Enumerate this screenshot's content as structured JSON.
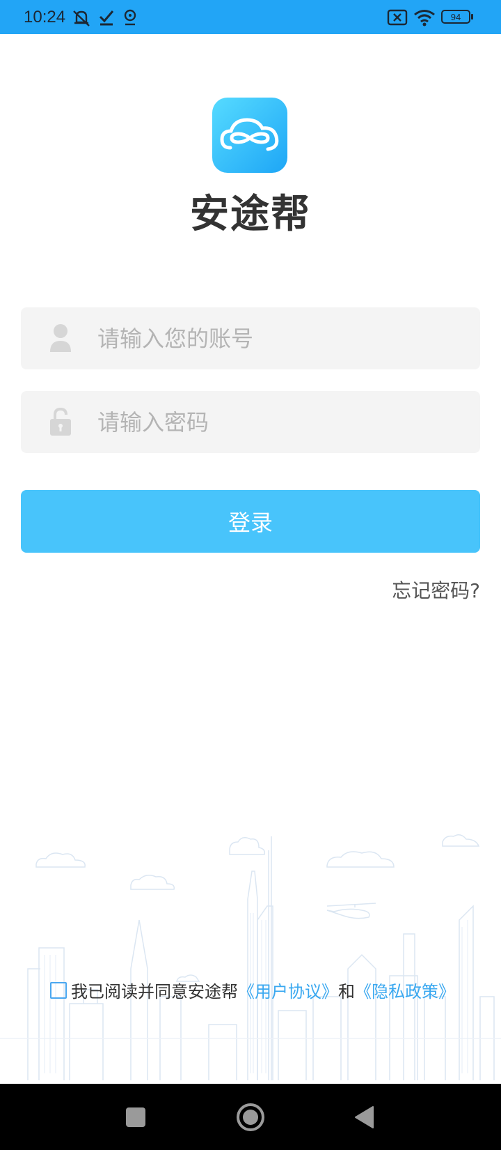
{
  "status_bar": {
    "time": "10:24",
    "battery": "94",
    "icons": [
      "mute-icon",
      "checkmark-icon",
      "location-icon",
      "sim-blocked-icon",
      "wifi-icon",
      "battery-icon"
    ]
  },
  "app": {
    "name": "安途帮",
    "logo_icon": "cloud-infinity-icon",
    "accent_color": "#48c4fb"
  },
  "login_form": {
    "account_placeholder": "请输入您的账号",
    "account_value": "",
    "password_placeholder": "请输入密码",
    "password_value": "",
    "login_label": "登录",
    "forgot_label": "忘记密码?"
  },
  "agreement": {
    "checked": false,
    "prefix": "我已阅读并同意安途帮",
    "user_agreement": "《用户协议》",
    "conjunction": "和",
    "privacy_policy": "《隐私政策》"
  },
  "nav_bar": {
    "buttons": [
      "recent-apps-icon",
      "home-icon",
      "back-icon"
    ]
  }
}
